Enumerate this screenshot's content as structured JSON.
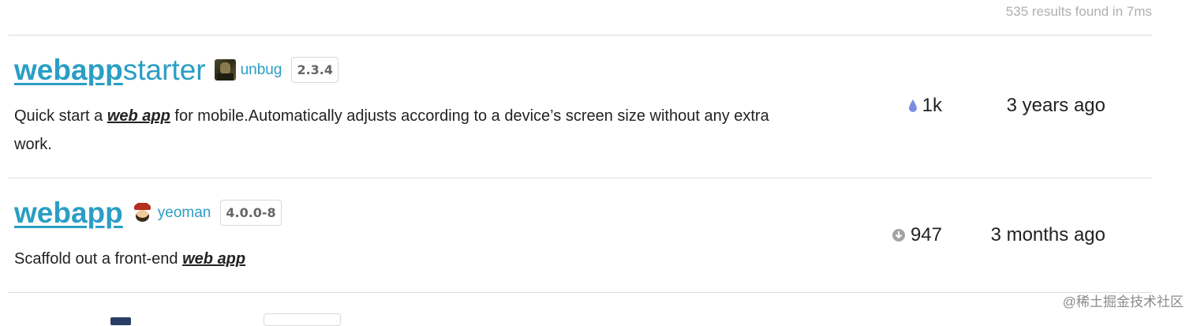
{
  "header": {
    "results_text": "535 results found in 7ms"
  },
  "results": [
    {
      "name_highlight": "webapp",
      "name_rest": "starter",
      "publisher": "unbug",
      "version": "2.3.4",
      "desc_before": "Quick start a ",
      "desc_highlight": "web app",
      "desc_after": " for mobile.Automatically adjusts according to a device’s screen size without any extra work.",
      "stat_icon": "drop-icon",
      "stat_value": "1k",
      "updated": "3 years ago"
    },
    {
      "name_highlight": "webapp",
      "name_rest": "",
      "publisher": "yeoman",
      "version": "4.0.0-8",
      "desc_before": "Scaffold out a front-end ",
      "desc_highlight": "web app",
      "desc_after": "",
      "stat_icon": "download-circle-icon",
      "stat_value": "947",
      "updated": "3 months ago"
    }
  ],
  "watermark": "@稀土掘金技术社区",
  "colors": {
    "accent": "#2a9ec4",
    "muted": "#b0b0b0",
    "drop": "#7b8fe0",
    "download": "#a3a3a3"
  }
}
